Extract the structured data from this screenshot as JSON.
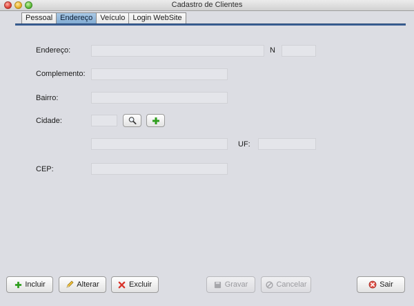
{
  "window": {
    "title": "Cadastro de Clientes"
  },
  "tabs": [
    {
      "label": "Pessoal"
    },
    {
      "label": "Endereço"
    },
    {
      "label": "Veículo"
    },
    {
      "label": "Login WebSite"
    }
  ],
  "form": {
    "endereco_label": "Endereço:",
    "numero_label": "N",
    "complemento_label": "Complemento:",
    "bairro_label": "Bairro:",
    "cidade_label": "Cidade:",
    "uf_label": "UF:",
    "cep_label": "CEP:",
    "endereco_value": "",
    "numero_value": "",
    "complemento_value": "",
    "bairro_value": "",
    "cidade_code_value": "",
    "cidade_name_value": "",
    "uf_value": "",
    "cep_value": ""
  },
  "buttons": {
    "incluir": "Incluir",
    "alterar": "Alterar",
    "excluir": "Excluir",
    "gravar": "Gravar",
    "cancelar": "Cancelar",
    "sair": "Sair"
  },
  "colors": {
    "active_tab": "#8fb4da",
    "tab_underline": "#3a5f94",
    "add_icon_green": "#2f9e1e",
    "delete_icon_red": "#d9342b"
  },
  "icons": {
    "search_button": "magnifier-icon",
    "add_button": "plus-icon"
  }
}
